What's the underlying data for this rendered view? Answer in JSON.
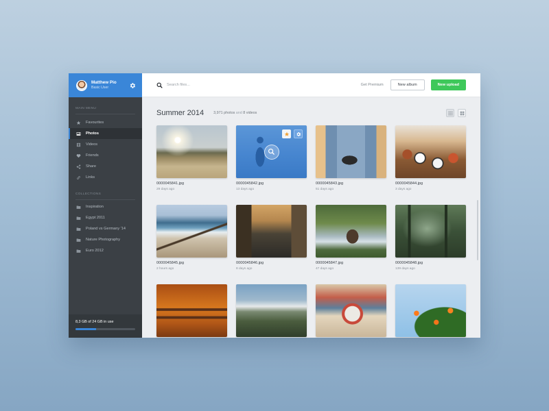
{
  "user": {
    "name": "Matthew Pio",
    "role": "Basic User"
  },
  "sidebar": {
    "main_menu_title": "MAIN MENU",
    "items": [
      {
        "label": "Favourites",
        "icon": "star-icon"
      },
      {
        "label": "Photos",
        "icon": "image-icon",
        "active": true
      },
      {
        "label": "Videos",
        "icon": "film-icon"
      },
      {
        "label": "Friends",
        "icon": "heart-icon"
      },
      {
        "label": "Share",
        "icon": "share-icon"
      },
      {
        "label": "Links",
        "icon": "link-icon"
      }
    ],
    "collections_title": "COLLECTIONS",
    "collections": [
      {
        "label": "Inspiration"
      },
      {
        "label": "Egypt 2011"
      },
      {
        "label": "Poland vs Germany '14"
      },
      {
        "label": "Nature Photography"
      },
      {
        "label": "Euro 2012"
      }
    ],
    "storage": {
      "text": "8,3 GB of 24 GB in use",
      "used_fraction": 0.35
    }
  },
  "topbar": {
    "search_placeholder": "Search files...",
    "premium_label": "Get Premium",
    "new_album_label": "New album",
    "new_upload_label": "New upload"
  },
  "album": {
    "title": "Summer 2014",
    "photos_count": "3,971 photos",
    "and_label": "and",
    "videos_count": "8 videos"
  },
  "files": [
    {
      "name": "0000045841.jpg",
      "date": "29 days ago"
    },
    {
      "name": "0000045842.jpg",
      "date": "13 days ago"
    },
    {
      "name": "0000045843.jpg",
      "date": "51 days ago"
    },
    {
      "name": "0000045844.jpg",
      "date": "3 days ago"
    },
    {
      "name": "0000045845.jpg",
      "date": "2 hours ago"
    },
    {
      "name": "0000045846.jpg",
      "date": "8 days ago"
    },
    {
      "name": "0000045847.jpg",
      "date": "47 days ago"
    },
    {
      "name": "0000045848.jpg",
      "date": "139 days ago"
    },
    {
      "name": "",
      "date": ""
    },
    {
      "name": "",
      "date": ""
    },
    {
      "name": "",
      "date": ""
    },
    {
      "name": "",
      "date": ""
    }
  ],
  "colors": {
    "accent": "#3a86d8",
    "upload_green": "#3ec85a",
    "sidebar_bg": "#3b4045",
    "star": "#f0a033"
  }
}
